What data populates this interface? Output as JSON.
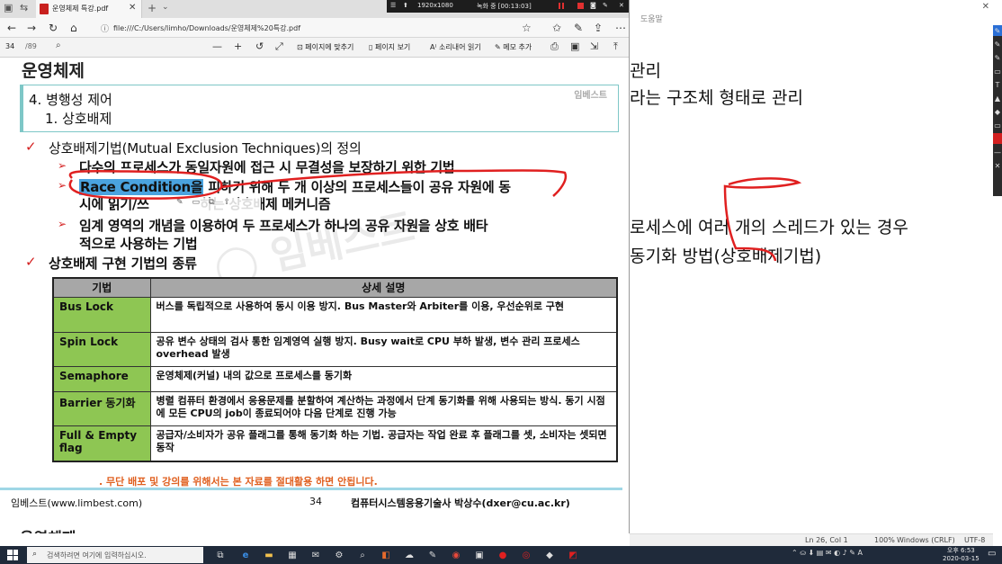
{
  "browser": {
    "tab_title": "운영체제 특강.pdf",
    "url": "file:///C:/Users/limho/Downloads/운영체제%20특강.pdf",
    "page_current": "34",
    "page_total": "/89",
    "tools": {
      "zoom_out": "—",
      "zoom_in": "+",
      "fit_page": "페이지에 맞추기",
      "page_view": "페이지 보기",
      "read_aloud": "소리내어 읽기",
      "add_note": "메모 추가"
    }
  },
  "recorder": {
    "resolution": "1920x1080",
    "status": "녹화 중 [00:13:03]"
  },
  "slide": {
    "header": "운영체제",
    "section": "4. 병행성 제어",
    "subsection": "1. 상호배제",
    "brand": "임베스트",
    "bullets": [
      "상호배제기법(Mutual Exclusion Techniques)의 정의",
      "다수의 프로세스가 동일자원에 접근 시 무결성을 보장하기 위한 기법",
      "Race Condition을",
      " 피하기 위해 두 개 이상의 프로세스들이 공유 자원에 동",
      "시에 읽기/쓰",
      " 하는 상호배제 메커니즘",
      "임계 영역의 개념을 이용하여 두 프로세스가 하나의 공유 자원을 상호 배타",
      "적으로 사용하는 기법",
      "상호배제 구현 기법의 종류"
    ],
    "table": {
      "headers": [
        "기법",
        "상세 설명"
      ],
      "rows": [
        {
          "name": "Bus Lock",
          "desc": "버스를 독립적으로 사용하여 동시 이용 방지. Bus Master와 Arbiter를 이용, 우선순위로 구현"
        },
        {
          "name": "Spin Lock",
          "desc": "공유 변수 상태의 검사 통한 임계영역 실행 방지. Busy wait로 CPU 부하 발생, 변수 관리 프로세스 overhead 발생"
        },
        {
          "name": "Semaphore",
          "desc": "운영체제(커널) 내의 값으로 프로세스를 동기화"
        },
        {
          "name": "Barrier 동기화",
          "desc": "병렬 컴퓨터 환경에서 응용문제를 분할하여 계산하는 과정에서 단계 동기화를 위해 사용되는 방식. 동기 시점에 모든 CPU의 job이 종료되어야 다음 단계로 진행 가능"
        },
        {
          "name": "Full & Empty flag",
          "desc": "공급자/소비자가 공유 플래그를 통해 동기화 하는 기법. 공급자는 작업 완료 후 플래그를 셋, 소비자는 셋되면 동작"
        }
      ]
    },
    "warning": ". 무단 배포 및 강의를 위해서는 본 자료를 절대활용 하면 안됩니다.",
    "footer_left": "임베스트(www.limbest.com)",
    "footer_page": "34",
    "footer_right": "컴퓨터시스템응용기술사 박상수(dxer@cu.ac.kr)",
    "next_header": "운영체제"
  },
  "notepad": {
    "title": "도움말",
    "lines": [
      "관리",
      "라는 구조체 형태로 관리",
      "로세스에 여러 개의 스레드가 있는 경우",
      "동기화 방법(상호배제기법)"
    ],
    "status": {
      "position": "Ln 26, Col 1",
      "zoom": "100%",
      "line_ending": "Windows (CRLF)",
      "encoding": "UTF-8"
    }
  },
  "taskbar": {
    "search_placeholder": "검색하려면 여기에 입력하십시오.",
    "time": "오후 6:53",
    "date": "2020-03-15",
    "lang": "A"
  },
  "colors": {
    "highlight": "#4aa3df",
    "table_name_bg": "#8ec653",
    "bullet_red": "#d42020",
    "annotation_red": "#e02020"
  }
}
